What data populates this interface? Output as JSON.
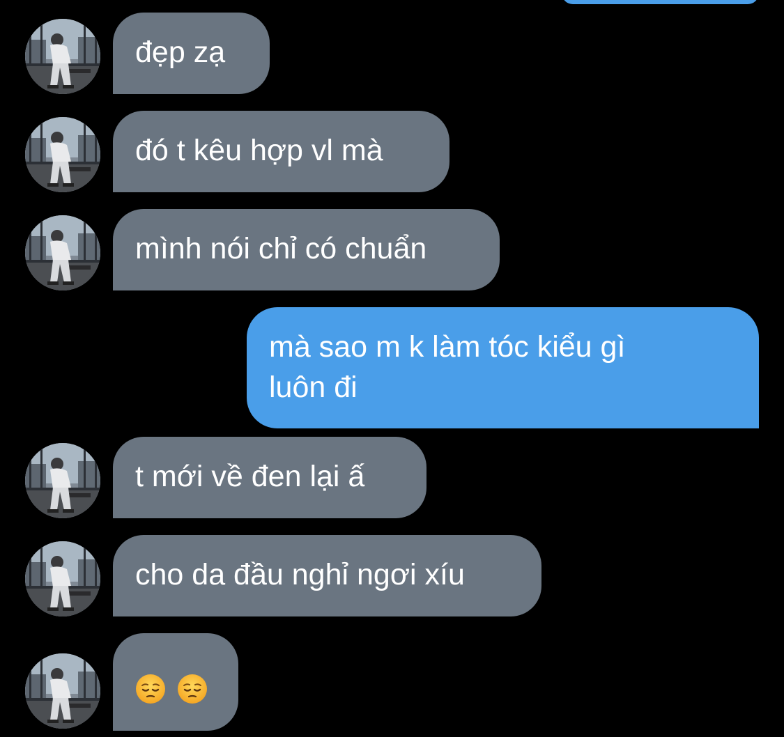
{
  "conversation": {
    "messages": [
      {
        "sender": "contact",
        "text": "đẹp zạ"
      },
      {
        "sender": "contact",
        "text": "đó t kêu hợp vl mà"
      },
      {
        "sender": "contact",
        "text": "mình nói chỉ có chuẩn"
      },
      {
        "sender": "me",
        "text_line1": "mà sao m k làm tóc kiểu gì",
        "text_line2": "luôn đi"
      },
      {
        "sender": "contact",
        "text": "t mới về đen lại ấ"
      },
      {
        "sender": "contact",
        "text": "cho da đầu nghỉ ngơi xíu"
      },
      {
        "sender": "contact",
        "emojis": [
          "pensive-face-emoji",
          "pensive-face-emoji"
        ]
      }
    ]
  },
  "colors": {
    "background": "#000000",
    "incoming_bubble": "#6a7581",
    "outgoing_bubble": "#4a9ee9",
    "text": "#ffffff"
  }
}
